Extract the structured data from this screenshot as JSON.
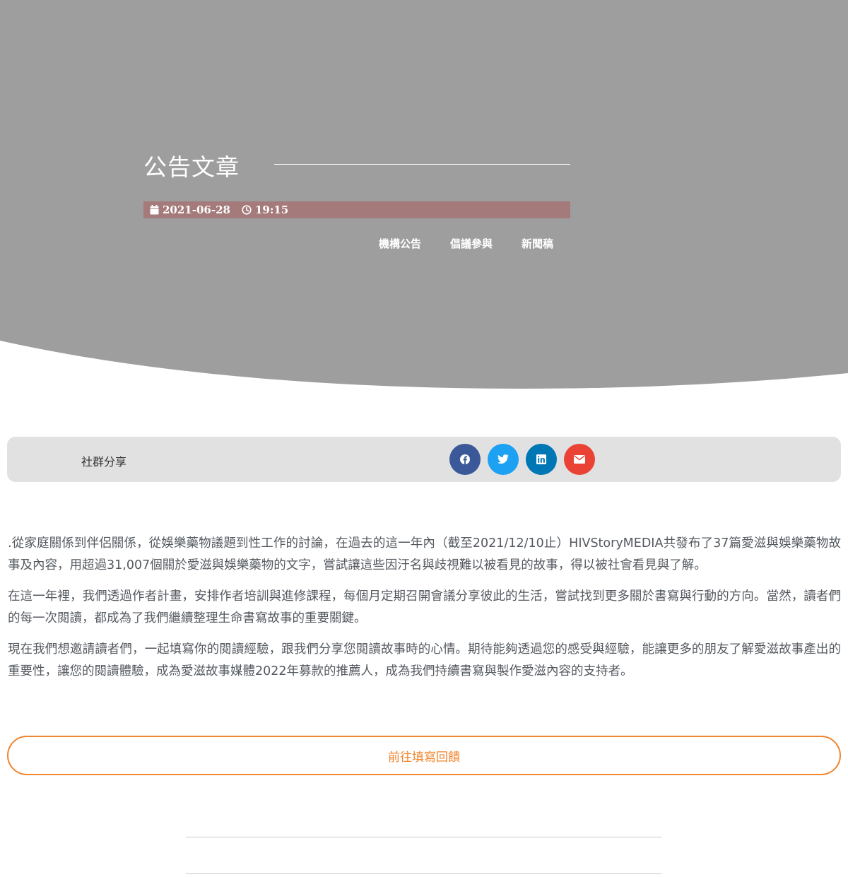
{
  "hero": {
    "title": "公告文章",
    "date": "2021-06-28",
    "time": "19:15",
    "categories": [
      "機構公告",
      "倡議參與",
      "新聞稿"
    ]
  },
  "share": {
    "label": "社群分享",
    "buttons": [
      {
        "name": "facebook",
        "color": "#3b5998"
      },
      {
        "name": "twitter",
        "color": "#1da1f2"
      },
      {
        "name": "linkedin",
        "color": "#0077b5"
      },
      {
        "name": "email",
        "color": "#ea4335"
      }
    ]
  },
  "article": {
    "paragraphs": [
      ".從家庭關係到伴侶關係，從娛樂藥物議題到性工作的討論，在過去的這一年內（截至2021/12/10止）HIVStoryMEDIA共發布了37篇愛滋與娛樂藥物故事及內容，用超過31,007個關於愛滋與娛樂藥物的文字，嘗試讓這些因汙名與歧視難以被看見的故事，得以被社會看見與了解。",
      "在這一年裡，我們透過作者計畫，安排作者培訓與進修課程，每個月定期召開會議分享彼此的生活，嘗試找到更多關於書寫與行動的方向。當然，讀者們的每一次閱讀，都成為了我們繼續整理生命書寫故事的重要關鍵。",
      "現在我們想邀請讀者們，一起填寫你的閱讀經驗，跟我們分享您閱讀故事時的心情。期待能夠透過您的感受與經驗，能讓更多的朋友了解愛滋故事產出的重要性，讓您的閱讀體驗，成為愛滋故事媒體2022年募款的推薦人，成為我們持續書寫與製作愛滋內容的支持者。"
    ],
    "cta_label": "前往填寫回饋"
  },
  "colors": {
    "hero_bg": "#9e9e9e",
    "meta_bar": "#a57a7a",
    "share_bar": "#e1e1e1",
    "accent": "#f0862e"
  }
}
